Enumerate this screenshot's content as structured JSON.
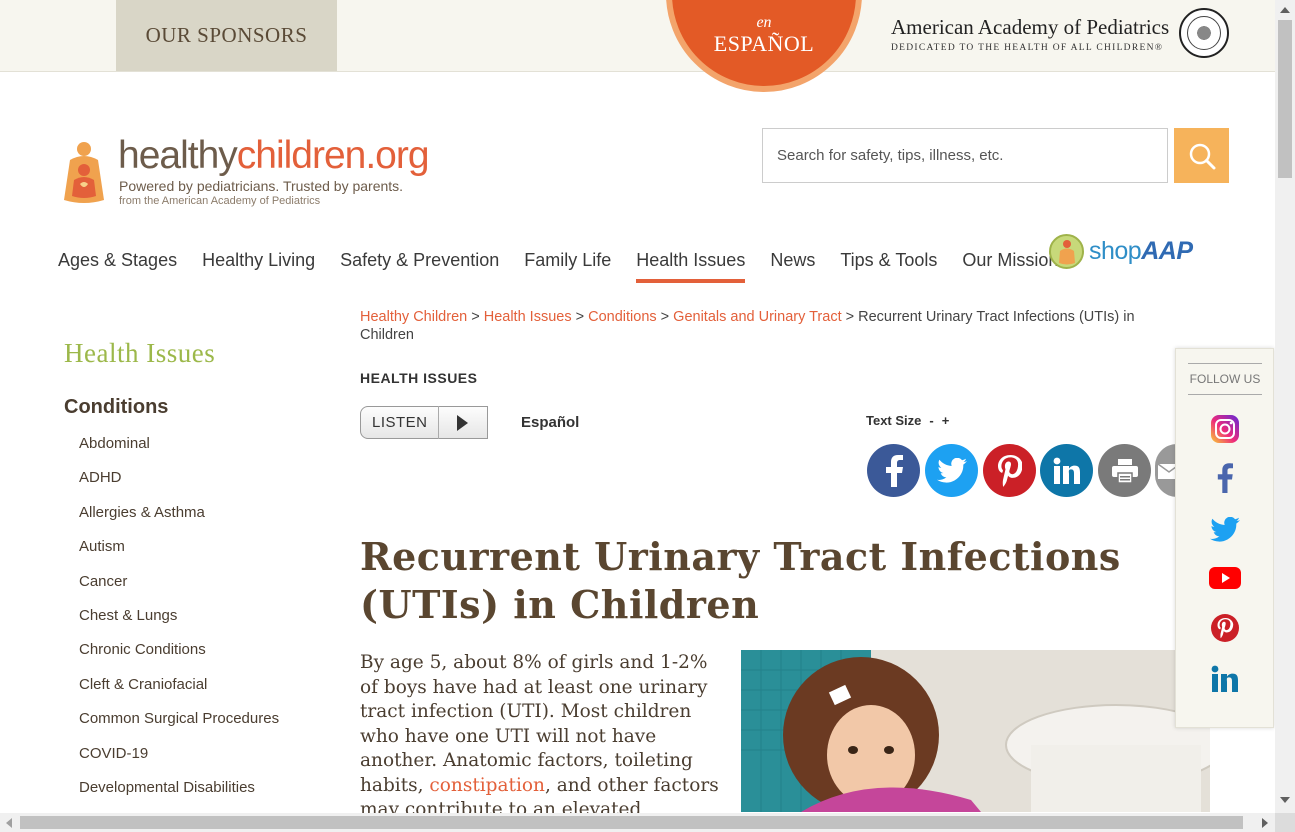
{
  "topbar": {
    "sponsors_label": "OUR SPONSORS",
    "espanol_en": "en",
    "espanol_label": "ESPAÑOL",
    "aap_name": "American Academy of Pediatrics",
    "aap_tagline": "DEDICATED TO THE HEALTH OF ALL CHILDREN®"
  },
  "logo": {
    "word_main": "healthy",
    "word_children": "children",
    "word_org": ".org",
    "tagline": "Powered by pediatricians. Trusted by parents.",
    "from": "from the American Academy of Pediatrics"
  },
  "search": {
    "placeholder": "Search for safety, tips, illness, etc.",
    "button_icon": "search-icon"
  },
  "nav": {
    "items": [
      {
        "label": "Ages & Stages"
      },
      {
        "label": "Healthy Living"
      },
      {
        "label": "Safety & Prevention"
      },
      {
        "label": "Family Life"
      },
      {
        "label": "Health Issues"
      },
      {
        "label": "News"
      },
      {
        "label": "Tips & Tools"
      },
      {
        "label": "Our Mission"
      }
    ],
    "active": "Health Issues",
    "shop_label_shop": "shop",
    "shop_label_aap": "AAP"
  },
  "sidebar": {
    "title": "Health Issues",
    "subtitle": "Conditions",
    "items": [
      {
        "label": "Abdominal"
      },
      {
        "label": "ADHD"
      },
      {
        "label": "Allergies & Asthma"
      },
      {
        "label": "Autism"
      },
      {
        "label": "Cancer"
      },
      {
        "label": "Chest & Lungs"
      },
      {
        "label": "Chronic Conditions"
      },
      {
        "label": "Cleft & Craniofacial"
      },
      {
        "label": "Common Surgical Procedures"
      },
      {
        "label": "COVID-19"
      },
      {
        "label": "Developmental Disabilities"
      }
    ]
  },
  "breadcrumb": {
    "links": [
      "Healthy Children",
      "Health Issues",
      "Conditions",
      "Genitals and Urinary Tract"
    ],
    "separator": ">",
    "current": "Recurrent Urinary Tract Infections (UTIs) in Children"
  },
  "section_label": "HEALTH ISSUES",
  "tools": {
    "listen_label": "LISTEN",
    "espanol_link": "Español",
    "text_size_label": "Text Size",
    "text_size_minus": "-",
    "text_size_plus": "+"
  },
  "share": {
    "facebook_color": "#3b5998",
    "twitter_color": "#1da1f2",
    "pinterest_color": "#cb2027",
    "linkedin_color": "#0e76a8",
    "print_color": "#7a7a7a",
    "email_color": "#999999"
  },
  "article": {
    "title": "Recurrent Urinary Tract Infections (UTIs) in Children",
    "body_before_link": "By age 5, about 8% of girls and 1-2% of boys have had at least one urinary tract infection (UTI). Most children who have one UTI will not have another. Anatomic factors, toileting habits, ",
    "body_link": "constipation",
    "body_after_link": ", and other factors may contribute to an elevated"
  },
  "follow": {
    "label": "FOLLOW US",
    "icons": [
      "instagram-icon",
      "facebook-icon",
      "twitter-icon",
      "youtube-icon",
      "pinterest-icon",
      "linkedin-icon"
    ]
  },
  "colors": {
    "accent": "#e3603a",
    "sidebar_title": "#9cb84a",
    "search_button": "#f6b35b"
  }
}
